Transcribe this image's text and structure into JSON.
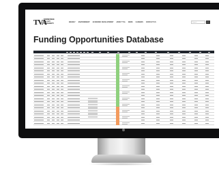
{
  "site": {
    "logo_mark": "TVA",
    "logo_text": "TENNESSEE\nVALLEY\nAUTHORITY",
    "nav": [
      "ENERGY",
      "ENVIRONMENT",
      "ECONOMIC DEVELOPMENT",
      "ABOUT TVA",
      "NEWS",
      "CAREERS",
      "CONTACT US"
    ],
    "search_placeholder": "Search",
    "search_button_icon": "search-icon"
  },
  "page": {
    "title": "Funding Opportunities Database"
  },
  "table": {
    "header_color": "#20252c",
    "status_colors": {
      "green": "#8fd07e",
      "orange": "#f39b5e"
    },
    "row_statuses": [
      "green",
      "green",
      "green",
      "green",
      "green",
      "green",
      "green",
      "green",
      "green",
      "green",
      "green",
      "green",
      "green",
      "green",
      "green",
      "green",
      "green",
      "orange",
      "orange",
      "orange",
      "orange",
      "orange",
      "orange"
    ]
  }
}
